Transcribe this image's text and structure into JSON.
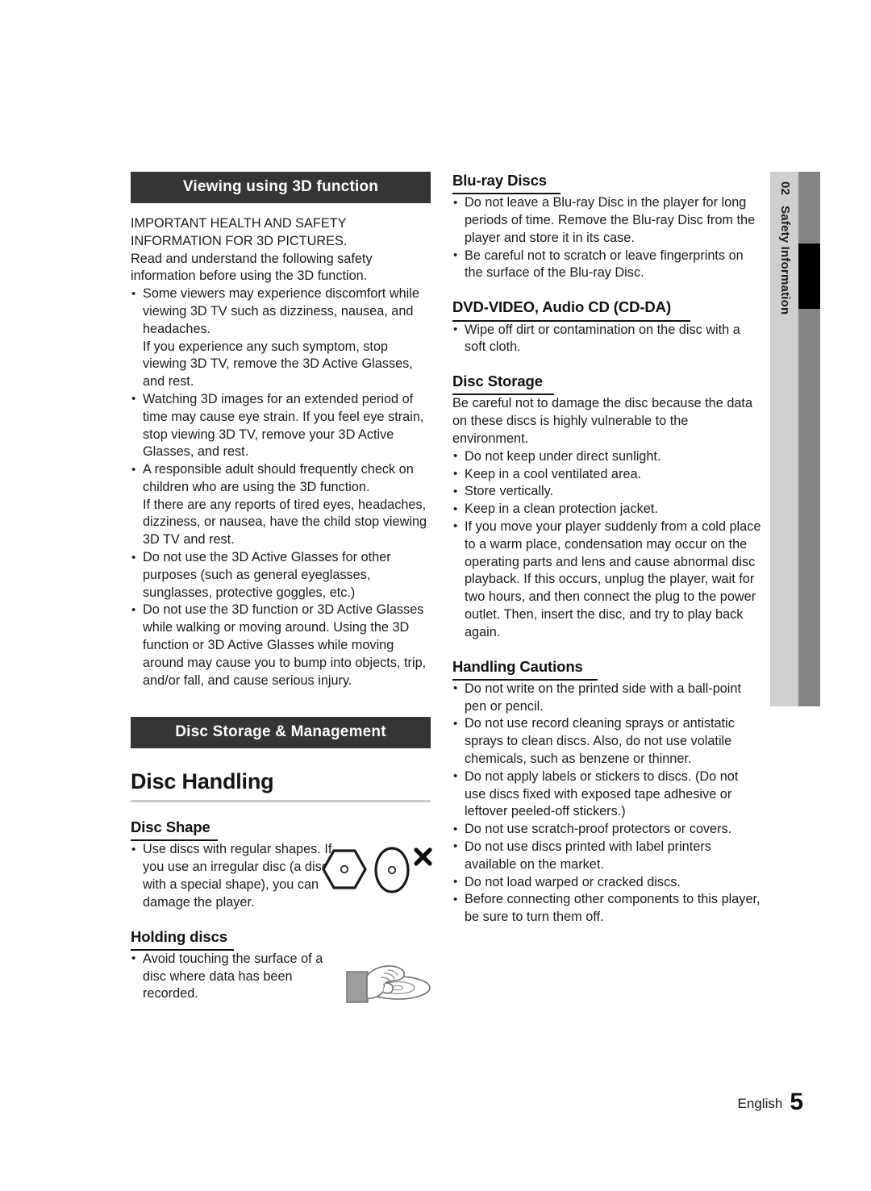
{
  "page": {
    "footer_language": "English",
    "footer_page_number": "5"
  },
  "chapter_tab": {
    "number": "02",
    "label": "Safety Information",
    "colors": {
      "light_band": "#cfcfcf",
      "dark_band": "#848484",
      "marker": "#000000"
    }
  },
  "left_column": {
    "banner_3d": "Viewing using 3D function",
    "intro": [
      "IMPORTANT HEALTH AND SAFETY INFORMATION FOR 3D PICTURES.",
      "Read and understand the following safety information before using the 3D function."
    ],
    "bullets_3d": [
      {
        "main": "Some viewers may experience discomfort while viewing 3D TV such as dizziness, nausea, and headaches.",
        "cont": "If you experience any such symptom, stop viewing 3D TV, remove the 3D Active Glasses, and rest."
      },
      {
        "main": "Watching 3D images for an extended period of time may cause eye strain. If you feel eye strain, stop viewing 3D TV, remove your 3D Active Glasses, and rest.",
        "cont": ""
      },
      {
        "main": "A responsible adult should frequently check on children who are using the 3D function.",
        "cont": "If there are any reports of tired eyes, headaches, dizziness, or nausea, have the child stop viewing 3D TV and rest."
      },
      {
        "main": "Do not use the 3D Active Glasses for other purposes (such as general eyeglasses, sunglasses, protective goggles, etc.)",
        "cont": ""
      },
      {
        "main": "Do not use the 3D function or 3D Active Glasses while walking or moving around. Using the 3D function or 3D Active Glasses while moving around may cause you to bump into objects, trip, and/or fall, and cause serious injury.",
        "cont": ""
      }
    ],
    "banner_storage": "Disc Storage & Management",
    "heading_disc_handling": "Disc Handling",
    "disc_shape": {
      "heading": "Disc Shape",
      "bullet": "Use discs with regular shapes. If you use an irregular disc (a disc with a special shape), you can damage the player."
    },
    "holding_discs": {
      "heading": "Holding discs",
      "bullet": "Avoid touching the surface of a disc where data has been recorded."
    }
  },
  "right_column": {
    "bluray": {
      "heading": "Blu-ray Discs",
      "bullets": [
        "Do not leave a Blu-ray Disc in the player for long periods of time. Remove the Blu-ray Disc from the player and store it in its case.",
        "Be careful not to scratch or leave fingerprints on the surface of the Blu-ray Disc."
      ]
    },
    "dvd": {
      "heading": "DVD-VIDEO, Audio CD (CD-DA)",
      "bullets": [
        "Wipe off dirt or contamination on the disc with a soft cloth."
      ]
    },
    "disc_storage": {
      "heading": "Disc Storage",
      "intro": "Be careful not to damage the disc because the data on these discs is highly vulnerable to the environment.",
      "bullets": [
        "Do not keep under direct sunlight.",
        "Keep in a cool ventilated area.",
        "Store vertically.",
        "Keep in a clean protection jacket.",
        "If you move your player suddenly from a cold place to a warm place, condensation may occur on the operating parts and lens and cause abnormal disc playback. If this occurs, unplug the player, wait for two hours, and then connect the plug to the power outlet. Then, insert the disc, and try to play back again."
      ]
    },
    "handling_cautions": {
      "heading": "Handling Cautions",
      "bullets": [
        "Do not write on the printed side with a ball-point pen or pencil.",
        "Do not use record cleaning sprays or antistatic sprays to clean discs. Also, do not use volatile chemicals, such as benzene or thinner.",
        "Do not apply labels or stickers to discs. (Do not use discs fixed with exposed tape adhesive or leftover peeled-off stickers.)",
        "Do not use scratch-proof protectors or covers.",
        "Do not use discs printed with label printers available on the market.",
        "Do not load warped or cracked discs.",
        "Before connecting other components to this player, be sure to turn them off."
      ]
    }
  }
}
